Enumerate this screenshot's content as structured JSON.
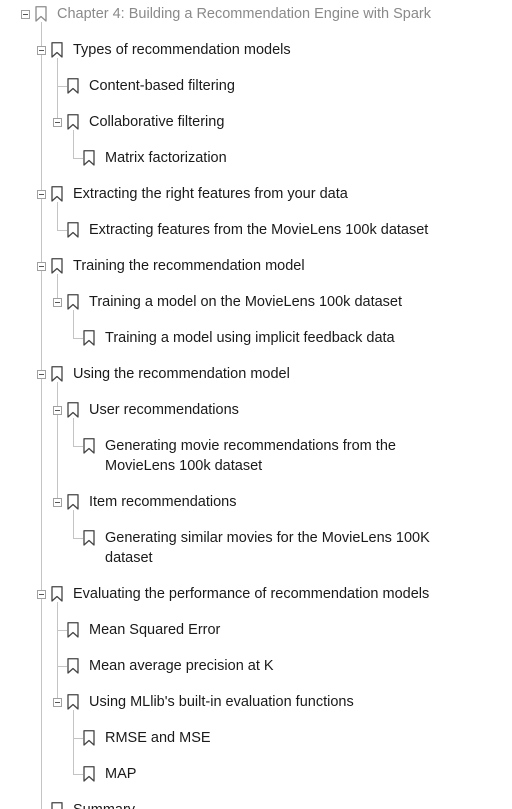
{
  "tree": [
    {
      "label": "Chapter 4: Building a Recommendation Engine with Spark",
      "depth": 0,
      "expanded": true,
      "faded": true
    },
    {
      "label": "Types of recommendation models",
      "depth": 1,
      "expanded": true
    },
    {
      "label": "Content-based filtering",
      "depth": 2
    },
    {
      "label": "Collaborative filtering",
      "depth": 2,
      "expanded": true
    },
    {
      "label": "Matrix factorization",
      "depth": 3
    },
    {
      "label": "Extracting the right features from your data",
      "depth": 1,
      "expanded": true
    },
    {
      "label": "Extracting features from the MovieLens 100k dataset",
      "depth": 2
    },
    {
      "label": "Training the recommendation model",
      "depth": 1,
      "expanded": true
    },
    {
      "label": "Training a model on the MovieLens 100k dataset",
      "depth": 2,
      "expanded": true
    },
    {
      "label": "Training a model using implicit feedback data",
      "depth": 3
    },
    {
      "label": "Using the recommendation model",
      "depth": 1,
      "expanded": true
    },
    {
      "label": "User recommendations",
      "depth": 2,
      "expanded": true
    },
    {
      "label": [
        "Generating movie recommendations from the",
        "MovieLens 100k dataset"
      ],
      "depth": 3
    },
    {
      "label": "Item recommendations",
      "depth": 2,
      "expanded": true
    },
    {
      "label": [
        "Generating similar movies for the MovieLens 100K",
        "dataset"
      ],
      "depth": 3
    },
    {
      "label": "Evaluating the performance of recommendation models",
      "depth": 1,
      "expanded": true
    },
    {
      "label": "Mean Squared Error",
      "depth": 2
    },
    {
      "label": "Mean average precision at K",
      "depth": 2
    },
    {
      "label": "Using MLlib's built-in evaluation functions",
      "depth": 2,
      "expanded": true
    },
    {
      "label": "RMSE and MSE",
      "depth": 3
    },
    {
      "label": "MAP",
      "depth": 3
    },
    {
      "label": "Summary",
      "depth": 1
    }
  ]
}
